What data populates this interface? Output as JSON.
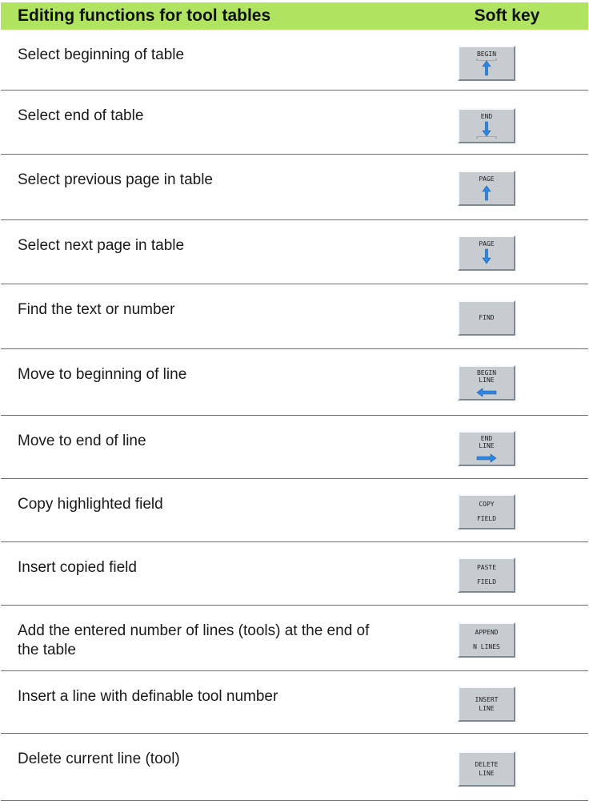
{
  "header": {
    "functions": "Editing functions for tool tables",
    "softkey": "Soft key"
  },
  "rows": [
    {
      "desc": "Select beginning of table",
      "key": [
        "BEGIN"
      ],
      "icon": "arrow-up-bar-top-icon"
    },
    {
      "desc": "Select end of table",
      "key": [
        "END"
      ],
      "icon": "arrow-down-bar-bottom-icon"
    },
    {
      "desc": "Select previous page in table",
      "key": [
        "PAGE"
      ],
      "icon": "arrow-up-icon"
    },
    {
      "desc": "Select next page in table",
      "key": [
        "PAGE"
      ],
      "icon": "arrow-down-icon"
    },
    {
      "desc": "Find the text or number",
      "key": [
        "FIND"
      ],
      "icon": ""
    },
    {
      "desc": "Move to beginning of line",
      "key": [
        "BEGIN",
        "LINE"
      ],
      "icon": "arrow-left-icon"
    },
    {
      "desc": "Move to end of line",
      "key": [
        "END",
        "LINE"
      ],
      "icon": "arrow-right-icon"
    },
    {
      "desc": "Copy highlighted field",
      "key": [
        "COPY",
        "FIELD"
      ],
      "icon": ""
    },
    {
      "desc": "Insert copied field",
      "key": [
        "PASTE",
        "FIELD"
      ],
      "icon": ""
    },
    {
      "desc": "Add the entered number of lines (tools) at the end of the table",
      "key": [
        "APPEND",
        "N LINES"
      ],
      "icon": ""
    },
    {
      "desc": "Insert a line with definable tool number",
      "key": [
        "INSERT",
        "LINE"
      ],
      "icon": ""
    },
    {
      "desc": "Delete current line (tool)",
      "key": [
        "DELETE",
        "LINE"
      ],
      "icon": ""
    }
  ],
  "colors": {
    "header_bg": "#b0e35f",
    "arrow": "#2f86e0",
    "key_bg": "#c7ccd1"
  }
}
